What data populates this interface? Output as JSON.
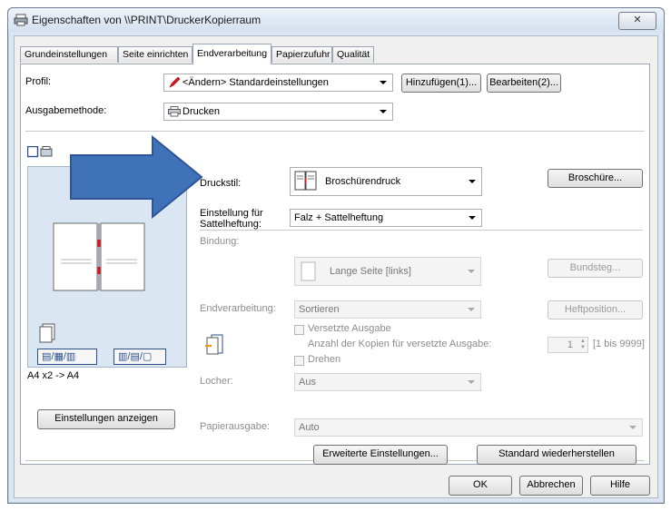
{
  "window": {
    "title": "Eigenschaften von \\\\PRINT\\DruckerKopierraum",
    "close_label": "✕"
  },
  "tabs": [
    {
      "label": "Grundeinstellungen"
    },
    {
      "label": "Seite einrichten"
    },
    {
      "label": "Endverarbeitung",
      "active": true
    },
    {
      "label": "Papierzufuhr"
    },
    {
      "label": "Qualität"
    }
  ],
  "profile": {
    "label": "Profil:",
    "value": "<Ändern> Standardeinstellungen",
    "add_button": "Hinzufügen(1)...",
    "edit_button": "Bearbeiten(2)..."
  },
  "output": {
    "label": "Ausgabemethode:",
    "value": "Drucken"
  },
  "preview": {
    "caption": "A4 x2 -> A4",
    "show_settings_button": "Einstellungen anzeigen"
  },
  "print_style": {
    "label": "Druckstil:",
    "value": "Broschürendruck",
    "button": "Broschüre..."
  },
  "saddle": {
    "label_line1": "Einstellung für",
    "label_line2": "Sattelheftung:",
    "value": "Falz + Sattelheftung"
  },
  "binding": {
    "label": "Bindung:",
    "value": "Lange Seite [links]",
    "button": "Bundsteg..."
  },
  "finishing": {
    "label": "Endverarbeitung:",
    "value": "Sortieren",
    "button": "Heftposition...",
    "offset_label": "Versetzte Ausgabe",
    "copies_label": "Anzahl der Kopien für versetzte Ausgabe:",
    "copies_value": "1",
    "copies_range": "[1 bis 9999]",
    "rotate_label": "Drehen"
  },
  "punch": {
    "label": "Locher:",
    "value": "Aus"
  },
  "paper_output": {
    "label": "Papierausgabe:",
    "value": "Auto"
  },
  "bottom": {
    "advanced_button": "Erweiterte Einstellungen...",
    "restore_button": "Standard wiederherstellen"
  },
  "dialog": {
    "ok": "OK",
    "cancel": "Abbrechen",
    "help": "Hilfe"
  },
  "colors": {
    "arrow_fill": "#3f72b8",
    "arrow_stroke": "#2e5597",
    "accent_red": "#e0141e"
  }
}
